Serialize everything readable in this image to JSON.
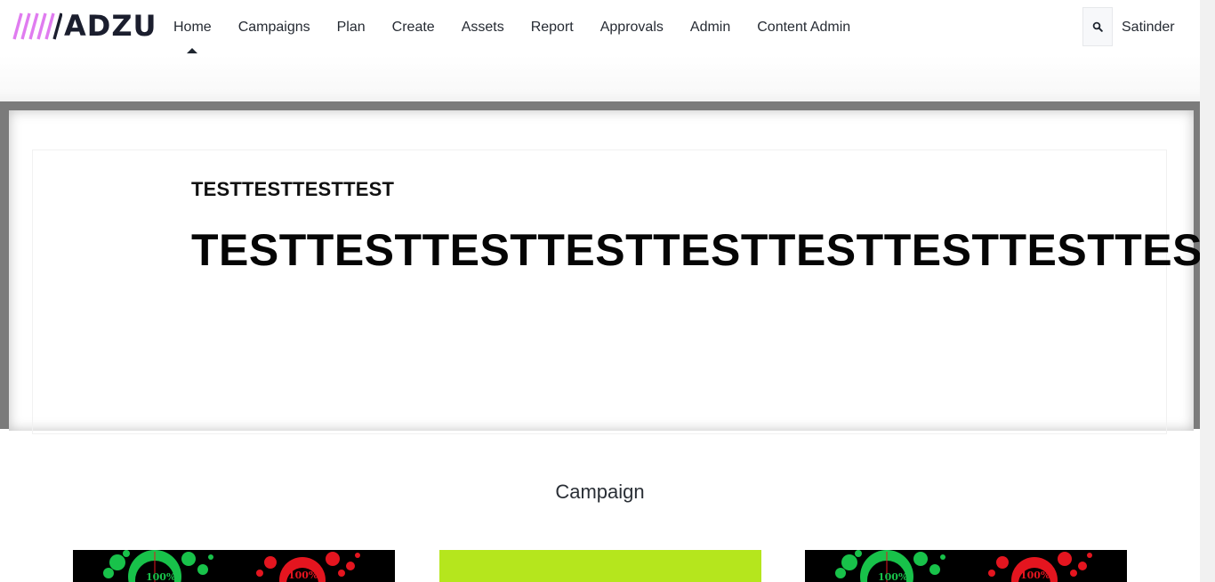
{
  "brand": {
    "name": "ADZU",
    "stripe_color": "#e07cf0"
  },
  "nav": {
    "items": [
      {
        "label": "Home",
        "active": true
      },
      {
        "label": "Campaigns",
        "active": false
      },
      {
        "label": "Plan",
        "active": false
      },
      {
        "label": "Create",
        "active": false
      },
      {
        "label": "Assets",
        "active": false
      },
      {
        "label": "Report",
        "active": false
      },
      {
        "label": "Approvals",
        "active": false
      },
      {
        "label": "Admin",
        "active": false
      },
      {
        "label": "Content Admin",
        "active": false
      }
    ]
  },
  "header_right": {
    "search_icon": "search-icon",
    "user": "Satinder"
  },
  "hero": {
    "subtitle": "TESTTESTTESTTEST",
    "title": "TESTTESTTESTTESTTESTTESTTESTTESTTEST"
  },
  "campaign_section": {
    "title": "Campaign",
    "cards": [
      {
        "badge_left": "100%",
        "badge_right": "100%",
        "bg": "#000000"
      },
      {
        "bg": "#b5e61d"
      },
      {
        "badge_left": "100%",
        "badge_right": "100%",
        "bg": "#000000"
      }
    ]
  },
  "colors": {
    "accent_green": "#18c24a",
    "accent_red": "#e4151f",
    "lime": "#b5e61d",
    "text": "#262b33"
  }
}
